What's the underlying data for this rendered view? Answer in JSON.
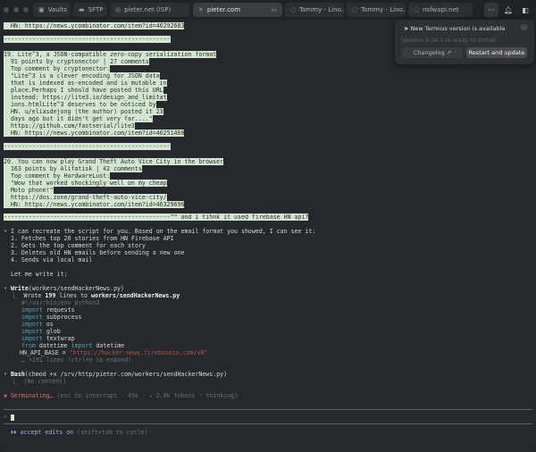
{
  "tabs": [
    {
      "label": "Vaults",
      "icon": "vault-icon"
    },
    {
      "label": "SFTP",
      "icon": "folder-icon"
    },
    {
      "label": "pieter.net (ISP)",
      "icon": "host-icon"
    },
    {
      "label": "pieter.com",
      "icon": "close-icon",
      "active": true
    },
    {
      "label": "Tommy - Lino...",
      "icon": "host-icon"
    },
    {
      "label": "Tommy - Lino...",
      "icon": "host-icon"
    },
    {
      "label": "nsfwapi.net",
      "icon": "host-icon"
    }
  ],
  "notification": {
    "title": "New Termius version is available",
    "subtitle": "Version 9.34.5 is ready to install.",
    "changelog": "Changelog ↗",
    "restart": "Restart and update"
  },
  "output": {
    "hn18": "  HN: https://news.ycombinator.com/item?id=46292683",
    "sep1": "-----------------------------------------------",
    "item19": [
      "19. Lite^3, a JSON-compatible zero-copy serialization format",
      "  91 points by cryptonector | 27 comments",
      "  Top comment by cryptonector:",
      "  \"Lite^3 is a clever encoding for JSON data",
      "  that is indexed as-encoded and is mutable in",
      "  place.Perhaps I should have posted this URL",
      "  instead: https://lite3.io/design_and_limitat",
      "  ions.htmlLite^3 deserves to be noticed by",
      "  HN. u/eliasdejong (the author) posted it 23",
      "  days ago but it didn't get very far....\"",
      "  https://github.com/fastserial/lite3",
      "  HN: https://news.ycombinator.com/item?id=46251468"
    ],
    "sep2": "-----------------------------------------------",
    "item20": [
      "20. You can now play Grand Theft Auto Vice City in the browser",
      "  163 points by Alifatisk | 42 comments",
      "  Top comment by HardwareLust:",
      "  \"Wow that worked shockingly well on my cheap",
      "  Moto phone!\"",
      "  https://dos.zone/grand-theft-auto-vice-city/",
      "  HN: https://news.ycombinator.com/item?id=46329696"
    ],
    "sep3": "-----------------------------------------------\"\" and i tihnk it used firebase HN api?"
  },
  "assistant": {
    "intro": "I can recreate the script for you. Based on the email format you showed, I can see it:",
    "steps": [
      "1. Fetches top 20 stories from HN Firebase API",
      "2. Gets the top comment for each story",
      "3. Deletes old HN emails before sending a new one",
      "4. Sends via local mail"
    ],
    "lets": "Let me write it:",
    "write_tool": "Write",
    "write_arg": "(workers/sendHackerNews.py)",
    "wrote_pre": "Wrote ",
    "wrote_count": "199",
    "wrote_mid": " lines to ",
    "wrote_file": "workers/sendHackerNews.py",
    "code": {
      "shebang": "#!/usr/bin/env python3",
      "imp": "import",
      "mods": [
        "requests",
        "subprocess",
        "os",
        "glob",
        "textwrap"
      ],
      "from": "from",
      "datetime": "datetime",
      "hn_var": "HN_API_BASE = ",
      "hn_url": "\"https://hacker-news.firebaseio.com/v0\"",
      "more": "… +191 lines (ctrl+o to expand)"
    },
    "bash_tool": "Bash",
    "bash_arg": "(chmod +x /srv/http/pieter.com/workers/sendHackerNews.py)",
    "bash_result": "(No content)",
    "status": "Germinating…",
    "status_hint": "(esc to interrupt · 49s · ↓ 2.0k tokens · thinking)"
  },
  "prompt": {
    "symbol": ">",
    "mode": "⏵⏵ accept edits on",
    "mode_hint": " (shift+tab to cycle)"
  }
}
